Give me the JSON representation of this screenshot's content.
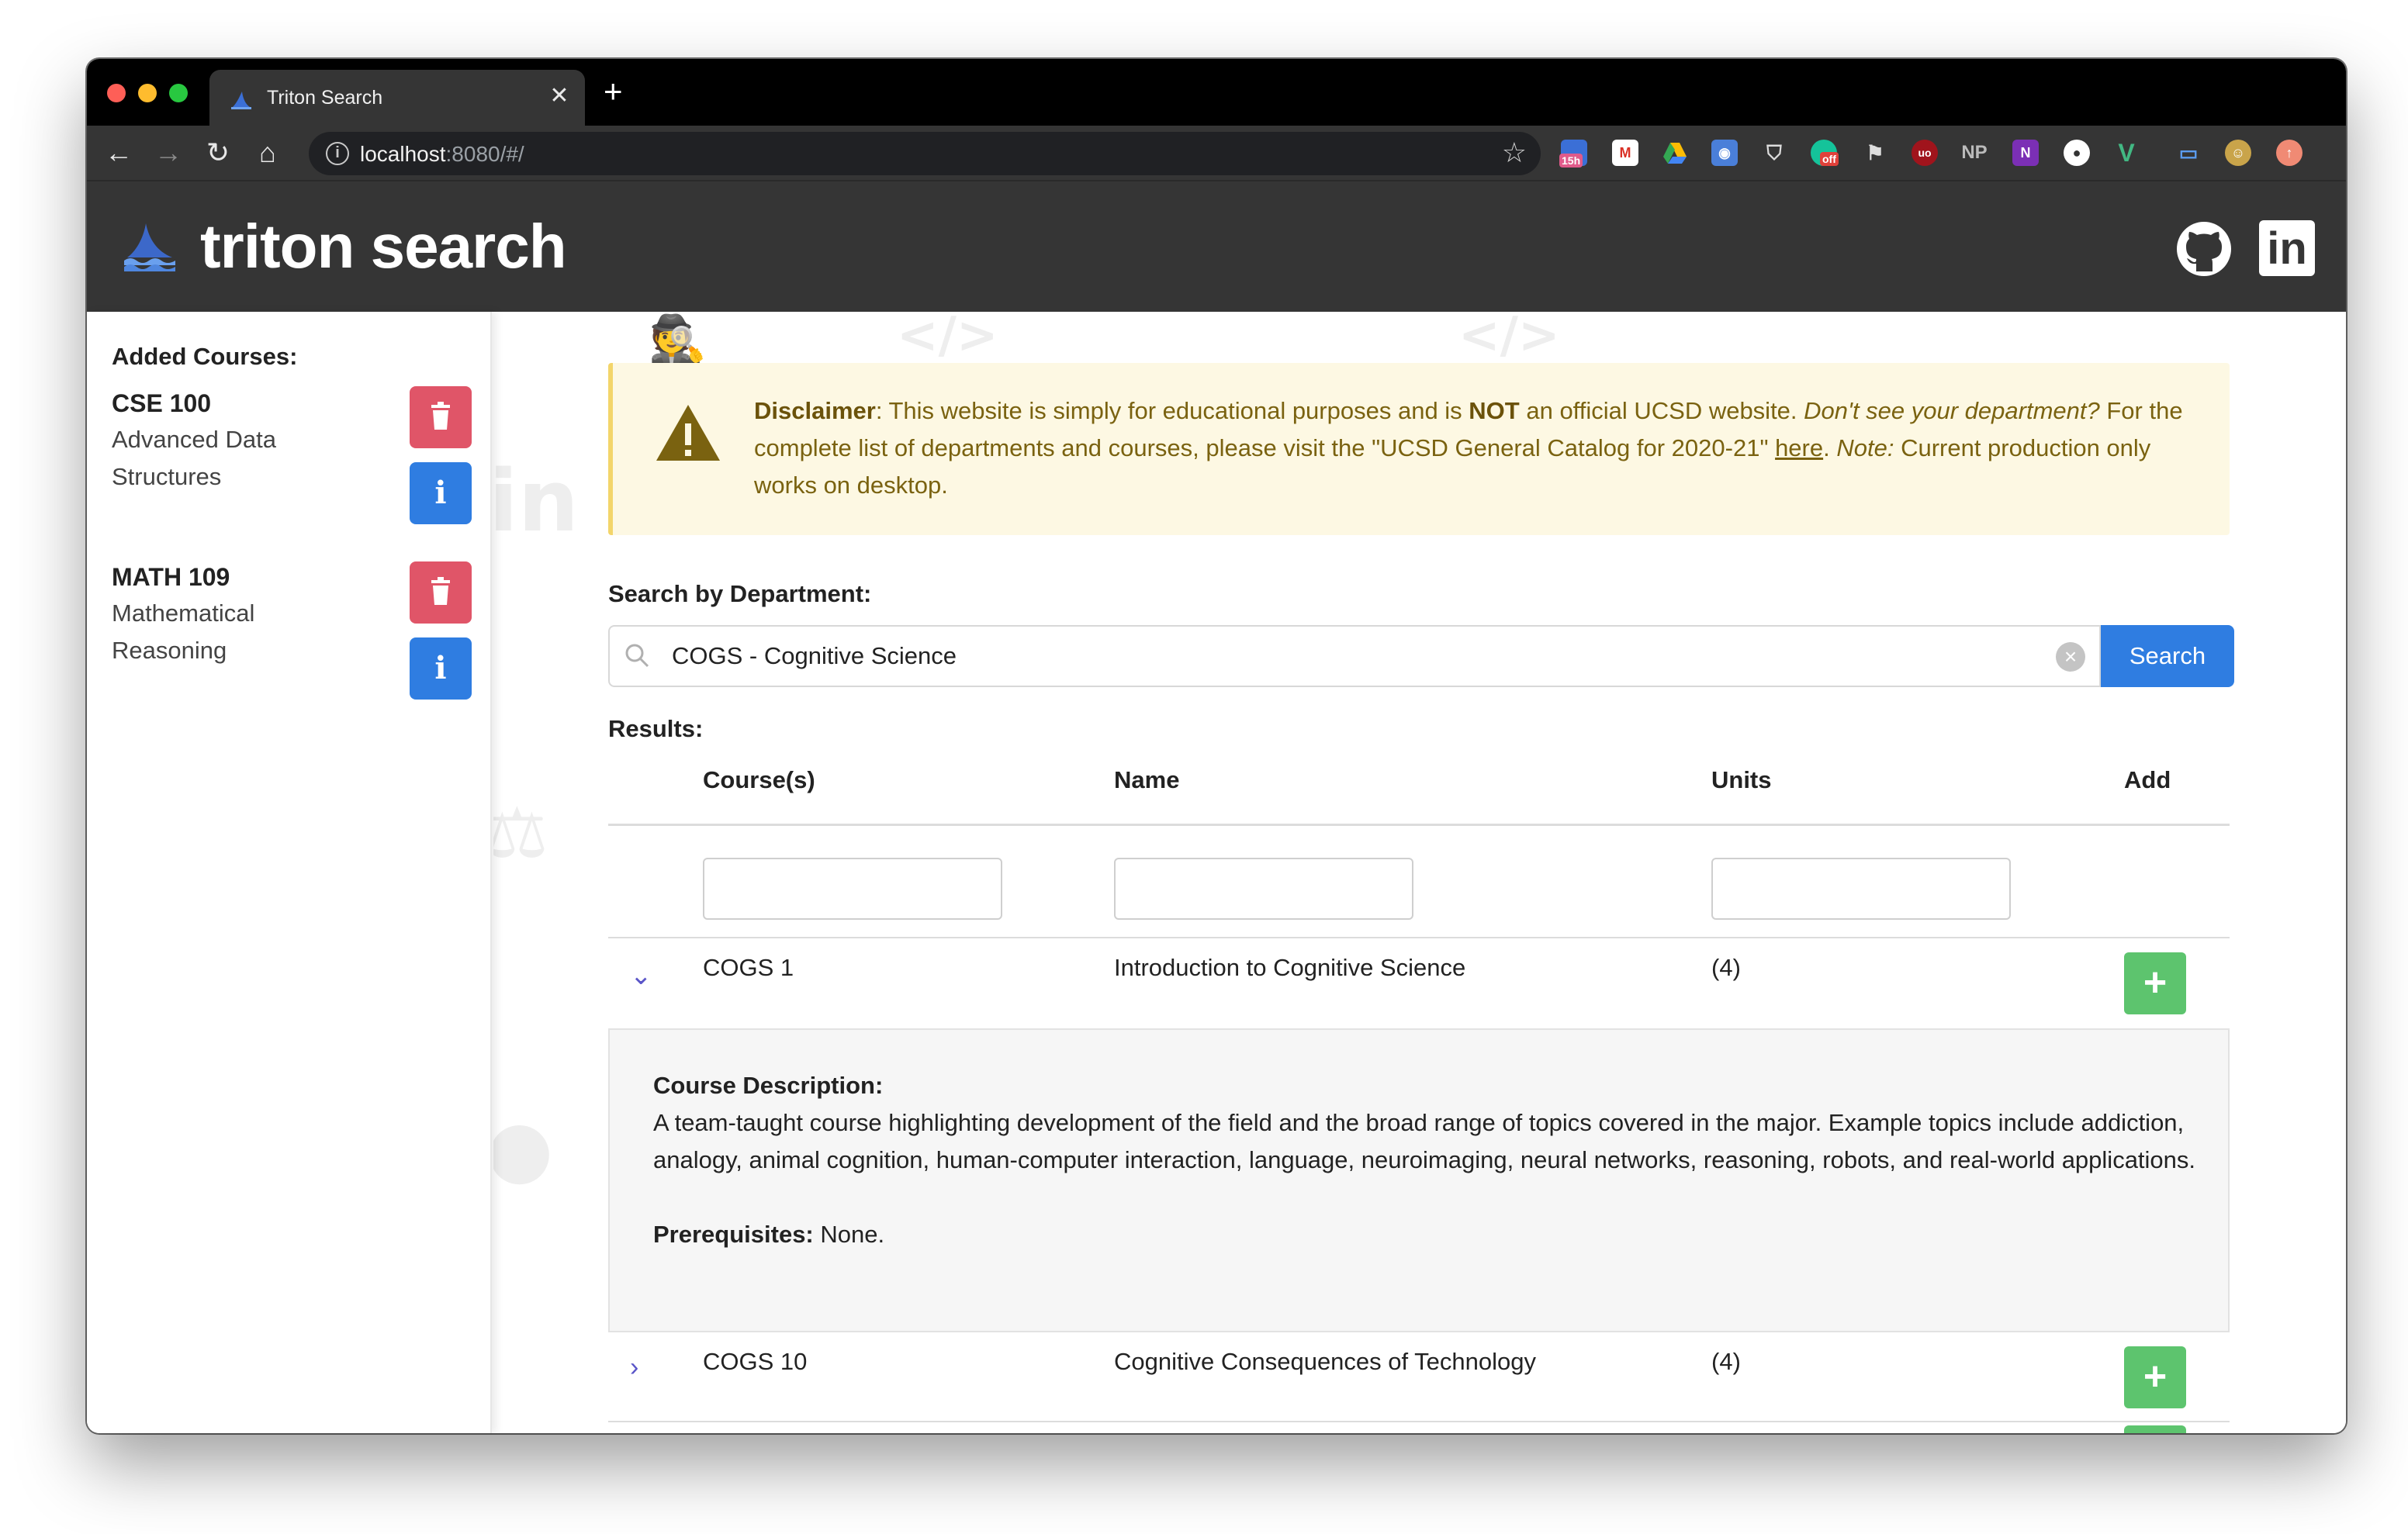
{
  "browser": {
    "tab_title": "Triton Search",
    "tab_close": "✕",
    "new_tab": "+",
    "url_host": "localhost",
    "url_rest": ":8080/#/",
    "extension_badge_15h": "15h",
    "extension_badge_off": "off",
    "extension_np": "NP"
  },
  "app": {
    "brand": "triton search",
    "accent": "#2f7de1",
    "header_bg": "#353535"
  },
  "sidebar": {
    "title": "Added Courses:",
    "courses": [
      {
        "code": "CSE 100",
        "title": "Advanced Data Structures"
      },
      {
        "code": "MATH 109",
        "title": "Mathematical Reasoning"
      }
    ]
  },
  "disclaimer": {
    "lead": "Disclaimer",
    "part1": ": This website is simply for educational purposes and is ",
    "not": "NOT",
    "part2": " an official UCSD website. ",
    "italic1": "Don't see your department?",
    "part3": " For the complete list of departments and courses, please visit the \"UCSD General Catalog for 2020-21\" ",
    "link": "here",
    "part4": ". ",
    "italic2": "Note:",
    "part5": " Current production only works on desktop."
  },
  "search": {
    "label": "Search by Department:",
    "value": "COGS - Cognitive Science",
    "button": "Search"
  },
  "results": {
    "label": "Results:",
    "columns": [
      "Course(s)",
      "Name",
      "Units",
      "Add"
    ],
    "rows": [
      {
        "code": "COGS 1",
        "name": "Introduction to Cognitive Science",
        "units": "(4)",
        "expanded": true
      },
      {
        "code": "COGS 10",
        "name": "Cognitive Consequences of Technology",
        "units": "(4)",
        "expanded": false
      }
    ],
    "detail": {
      "desc_label": "Course Description:",
      "desc": "A team-taught course highlighting development of the field and the broad range of topics covered in the major. Example topics include addiction, analogy, animal cognition, human-computer interaction, language, neuroimaging, neural networks, reasoning, robots, and real-world applications.",
      "prereq_label": "Prerequisites:",
      "prereq": "None."
    }
  }
}
